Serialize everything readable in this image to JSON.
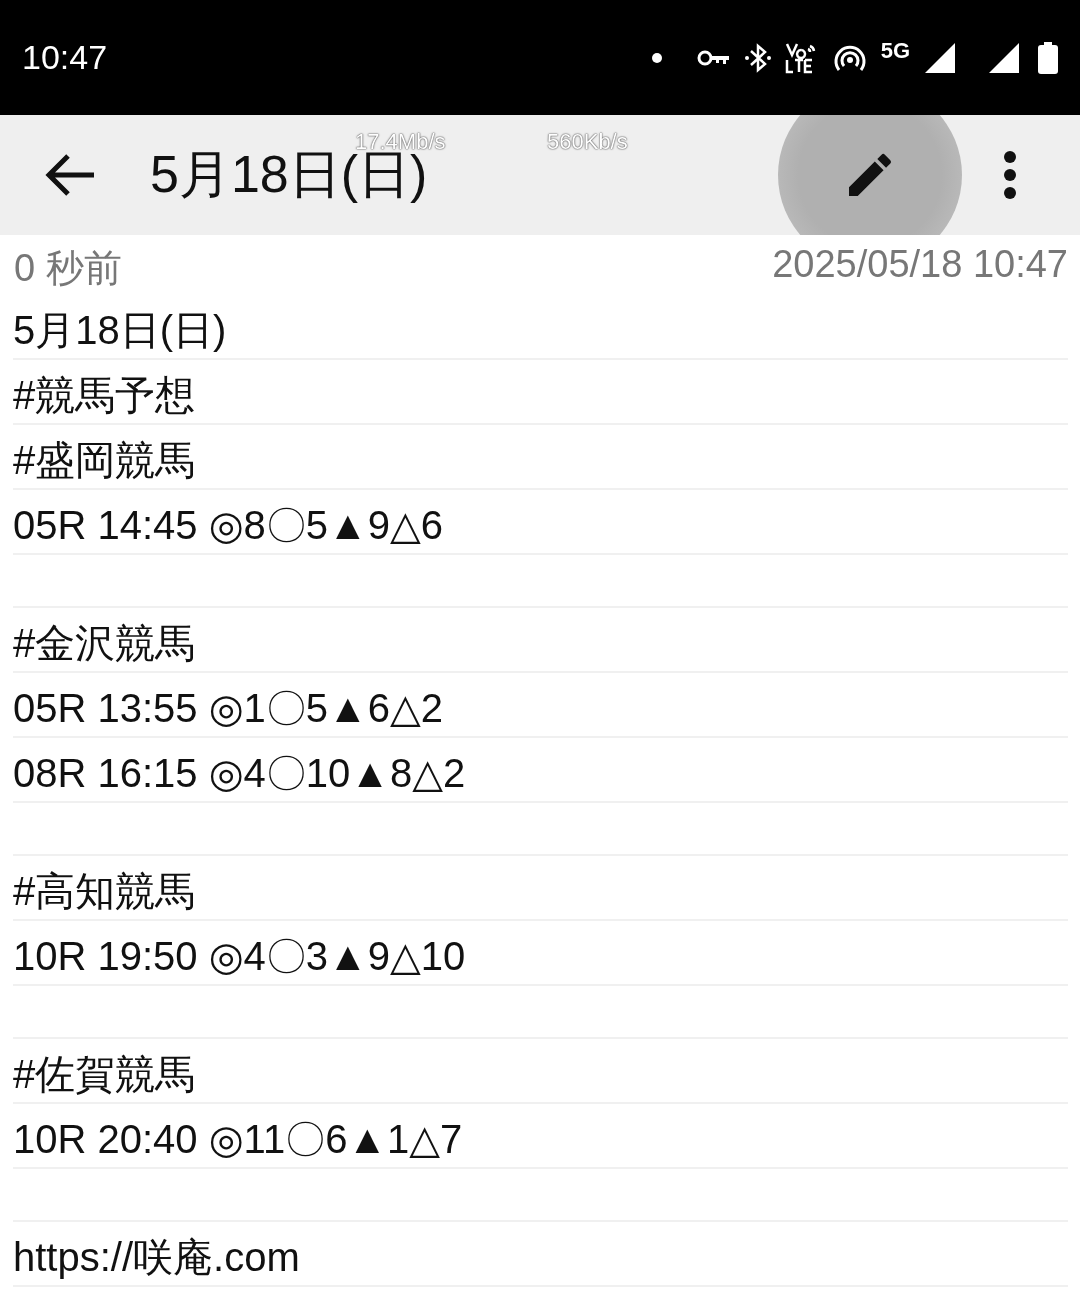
{
  "status_bar": {
    "time": "10:47",
    "network_label": "5G"
  },
  "app_bar": {
    "title": "5月18日(日)",
    "speeds": [
      "17.4Mb/s",
      "560Kb/s"
    ],
    "edit_pressed": true
  },
  "meta": {
    "relative_time": "0 秒前",
    "timestamp": "2025/05/18 10:47"
  },
  "note": {
    "sections": [
      {
        "lines": [
          "5月18日(日)",
          "#競馬予想",
          "#盛岡競馬",
          "05R 14:45 ◎8〇5▲9△6"
        ]
      },
      {
        "lines": [
          "#金沢競馬",
          "05R 13:55 ◎1〇5▲6△2",
          "08R 16:15 ◎4〇10▲8△2"
        ]
      },
      {
        "lines": [
          "#高知競馬",
          "10R 19:50 ◎4〇3▲9△10"
        ]
      },
      {
        "lines": [
          "#佐賀競馬",
          "10R 20:40 ◎11〇6▲1△7"
        ]
      },
      {
        "lines": [
          "https://咲庵.com"
        ]
      }
    ]
  }
}
